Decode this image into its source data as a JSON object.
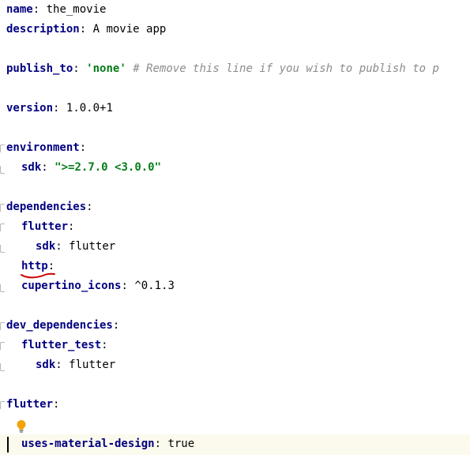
{
  "lines": {
    "name_key": "name",
    "name_val": "the_movie",
    "description_key": "description",
    "description_val": "A movie app",
    "publish_key": "publish_to",
    "publish_val": "'none'",
    "publish_comment": "# Remove this line if you wish to publish to p",
    "version_key": "version",
    "version_val": "1.0.0+1",
    "environment_key": "environment",
    "sdk_key": "sdk",
    "sdk_val": "\">=2.7.0 <3.0.0\"",
    "dependencies_key": "dependencies",
    "flutter_key": "flutter",
    "flutter_sdk_key": "sdk",
    "flutter_sdk_val": "flutter",
    "http_key": "http",
    "cupertino_key": "cupertino_icons",
    "cupertino_val": "^0.1.3",
    "dev_dependencies_key": "dev_dependencies",
    "flutter_test_key": "flutter_test",
    "flutter_test_sdk_key": "sdk",
    "flutter_test_sdk_val": "flutter",
    "flutter_section_key": "flutter",
    "uses_material_key": "uses-material-design",
    "uses_material_val": "true"
  },
  "punct": {
    "colon": ":"
  },
  "colors": {
    "key": "#000080",
    "string": "#067d17",
    "comment": "#8c8c8c",
    "current_line": "#fcfaed",
    "annotation": "#cc0000",
    "bulb": "#f0a30a"
  },
  "icons": {
    "gutter_hint": "lightbulb-icon",
    "fold_marker": "fold-marker-icon"
  }
}
